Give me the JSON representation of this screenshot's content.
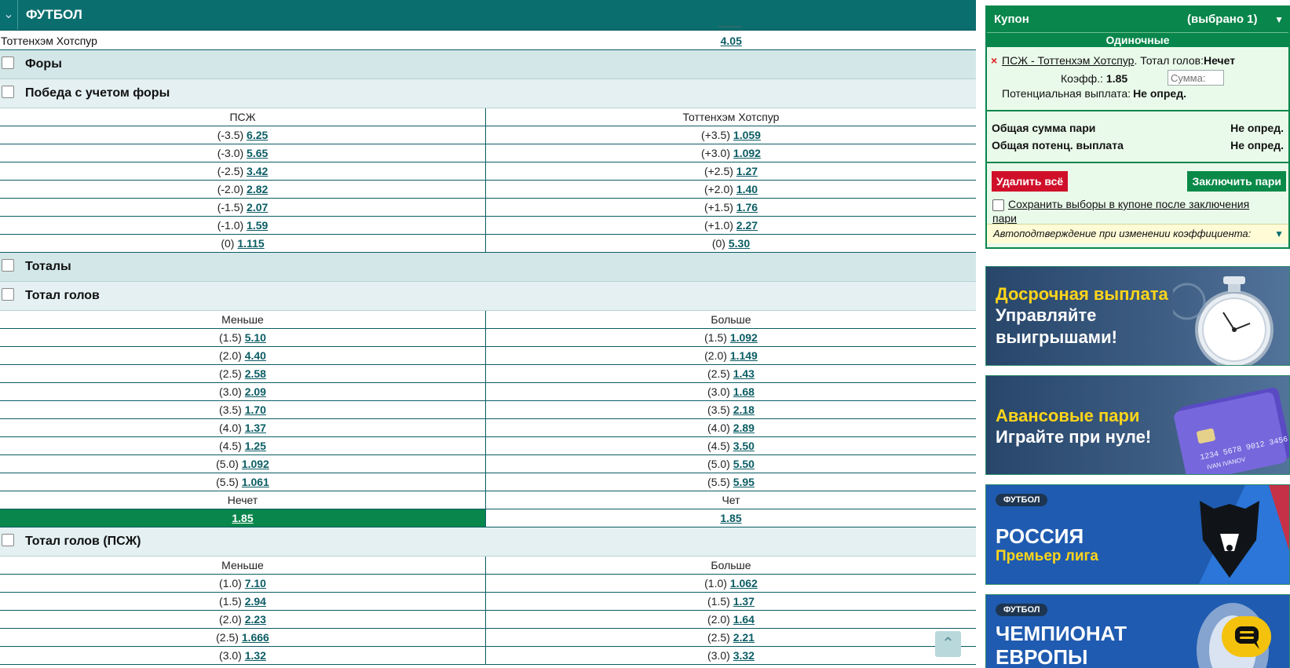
{
  "header": {
    "title": "ФУТБОЛ",
    "peek_odd": ""
  },
  "top_team_row": {
    "team": "Тоттенхэм Хотспур",
    "odd": "4.05"
  },
  "sections": {
    "handicaps": {
      "title": "Форы"
    },
    "handicap_win": {
      "title": "Победа с учетом форы",
      "left_header": "ПСЖ",
      "right_header": "Тоттенхэм Хотспур",
      "rows": [
        {
          "lh": "(-3.5)",
          "lo": "6.25",
          "rh": "(+3.5)",
          "ro": "1.059"
        },
        {
          "lh": "(-3.0)",
          "lo": "5.65",
          "rh": "(+3.0)",
          "ro": "1.092"
        },
        {
          "lh": "(-2.5)",
          "lo": "3.42",
          "rh": "(+2.5)",
          "ro": "1.27"
        },
        {
          "lh": "(-2.0)",
          "lo": "2.82",
          "rh": "(+2.0)",
          "ro": "1.40"
        },
        {
          "lh": "(-1.5)",
          "lo": "2.07",
          "rh": "(+1.5)",
          "ro": "1.76"
        },
        {
          "lh": "(-1.0)",
          "lo": "1.59",
          "rh": "(+1.0)",
          "ro": "2.27"
        },
        {
          "lh": "(0)",
          "lo": "1.115",
          "rh": "(0)",
          "ro": "5.30"
        }
      ]
    },
    "totals": {
      "title": "Тоталы"
    },
    "total_goals": {
      "title": "Тотал голов",
      "left_header": "Меньше",
      "right_header": "Больше",
      "rows": [
        {
          "lh": "(1.5)",
          "lo": "5.10",
          "rh": "(1.5)",
          "ro": "1.092"
        },
        {
          "lh": "(2.0)",
          "lo": "4.40",
          "rh": "(2.0)",
          "ro": "1.149"
        },
        {
          "lh": "(2.5)",
          "lo": "2.58",
          "rh": "(2.5)",
          "ro": "1.43"
        },
        {
          "lh": "(3.0)",
          "lo": "2.09",
          "rh": "(3.0)",
          "ro": "1.68"
        },
        {
          "lh": "(3.5)",
          "lo": "1.70",
          "rh": "(3.5)",
          "ro": "2.18"
        },
        {
          "lh": "(4.0)",
          "lo": "1.37",
          "rh": "(4.0)",
          "ro": "2.89"
        },
        {
          "lh": "(4.5)",
          "lo": "1.25",
          "rh": "(4.5)",
          "ro": "3.50"
        },
        {
          "lh": "(5.0)",
          "lo": "1.092",
          "rh": "(5.0)",
          "ro": "5.50"
        },
        {
          "lh": "(5.5)",
          "lo": "1.061",
          "rh": "(5.5)",
          "ro": "5.95"
        }
      ],
      "odd_even": {
        "left_header": "Нечет",
        "right_header": "Чет",
        "left_odd": "1.85",
        "right_odd": "1.85",
        "selected": "left"
      }
    },
    "total_goals_psg": {
      "title": "Тотал голов (ПСЖ)",
      "left_header": "Меньше",
      "right_header": "Больше",
      "rows": [
        {
          "lh": "(1.0)",
          "lo": "7.10",
          "rh": "(1.0)",
          "ro": "1.062"
        },
        {
          "lh": "(1.5)",
          "lo": "2.94",
          "rh": "(1.5)",
          "ro": "1.37"
        },
        {
          "lh": "(2.0)",
          "lo": "2.23",
          "rh": "(2.0)",
          "ro": "1.64"
        },
        {
          "lh": "(2.5)",
          "lo": "1.666",
          "rh": "(2.5)",
          "ro": "2.21"
        },
        {
          "lh": "(3.0)",
          "lo": "1.32",
          "rh": "(3.0)",
          "ro": "3.32"
        }
      ]
    }
  },
  "coupon": {
    "title": "Купон",
    "selected_count": "(выбрано 1)",
    "singles_label": "Одиночные",
    "bet": {
      "match": "ПСЖ - Тоттенхэм Хотспур",
      "market": ". Тотал голов:",
      "pick": "Нечет",
      "odd_label": "Коэфф.:",
      "odd_value": "1.85",
      "sum_placeholder": "Сумма:",
      "payout_label": "Потенциальная выплата:",
      "payout_value": "Не опред."
    },
    "total_stake_label": "Общая сумма пари",
    "total_stake_value": "Не опред.",
    "total_payout_label": "Общая потенц. выплата",
    "total_payout_value": "Не опред.",
    "delete_all": "Удалить всё",
    "place_bet": "Заключить пари",
    "keep_selections": "Сохранить выборы в купоне после заключения пари",
    "auto_confirm": "Автоподтверждение при изменении коэффициента:"
  },
  "banners": [
    {
      "line1": "Досрочная выплата",
      "line2": "Управляйте",
      "line3": "выигрышами!"
    },
    {
      "line1": "Авансовые пари",
      "line2": "Играйте при нуле!",
      "card_text": "1234 5678 9012 3456",
      "card_name": "IVAN IVANOV"
    },
    {
      "pill": "ФУТБОЛ",
      "line1": "РОССИЯ",
      "line2": "Премьер лига"
    },
    {
      "pill": "ФУТБОЛ",
      "line1": "ЧЕМПИОНАТ",
      "line2": "ЕВРОПЫ"
    }
  ],
  "colors": {
    "brand": "#0b6e6e",
    "coupon_green": "#08864b",
    "delete_red": "#d0102a",
    "accent_yellow": "#ffd51a"
  },
  "icons": {
    "collapse": "chevron-down-icon",
    "scroll_top": "chevron-up-icon",
    "chat": "chat-icon",
    "remove": "close-icon"
  }
}
